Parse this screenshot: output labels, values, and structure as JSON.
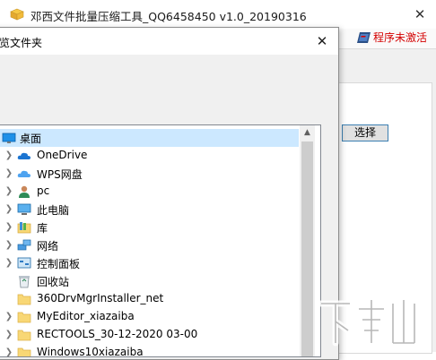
{
  "main_window": {
    "title": "邓西文件批量压缩工具_QQ6458450 v1.0_20190316",
    "close_glyph": "✕",
    "activation_label": "程序未激活",
    "select_button_label": "选择"
  },
  "dialog": {
    "title": "览文件夹",
    "close_glyph": "✕"
  },
  "tree": {
    "items": [
      {
        "label": "桌面",
        "icon": "desktop-icon"
      },
      {
        "label": "OneDrive",
        "icon": "onedrive-cloud-icon"
      },
      {
        "label": "WPS网盘",
        "icon": "wps-cloud-icon"
      },
      {
        "label": "pc",
        "icon": "user-icon"
      },
      {
        "label": "此电脑",
        "icon": "computer-icon"
      },
      {
        "label": "库",
        "icon": "library-icon"
      },
      {
        "label": "网络",
        "icon": "network-icon"
      },
      {
        "label": "控制面板",
        "icon": "control-panel-icon"
      },
      {
        "label": "回收站",
        "icon": "recycle-bin-icon"
      },
      {
        "label": "360DrvMgrInstaller_net",
        "icon": "folder-icon"
      },
      {
        "label": "MyEditor_xiazaiba",
        "icon": "folder-icon"
      },
      {
        "label": "RECTOOLS_30-12-2020 03-00",
        "icon": "folder-icon"
      },
      {
        "label": "Windows10xiazaiba",
        "icon": "folder-icon"
      }
    ]
  },
  "colors": {
    "selection": "#cce8ff",
    "activation_text": "#d40000",
    "folder": "#f8d775"
  }
}
